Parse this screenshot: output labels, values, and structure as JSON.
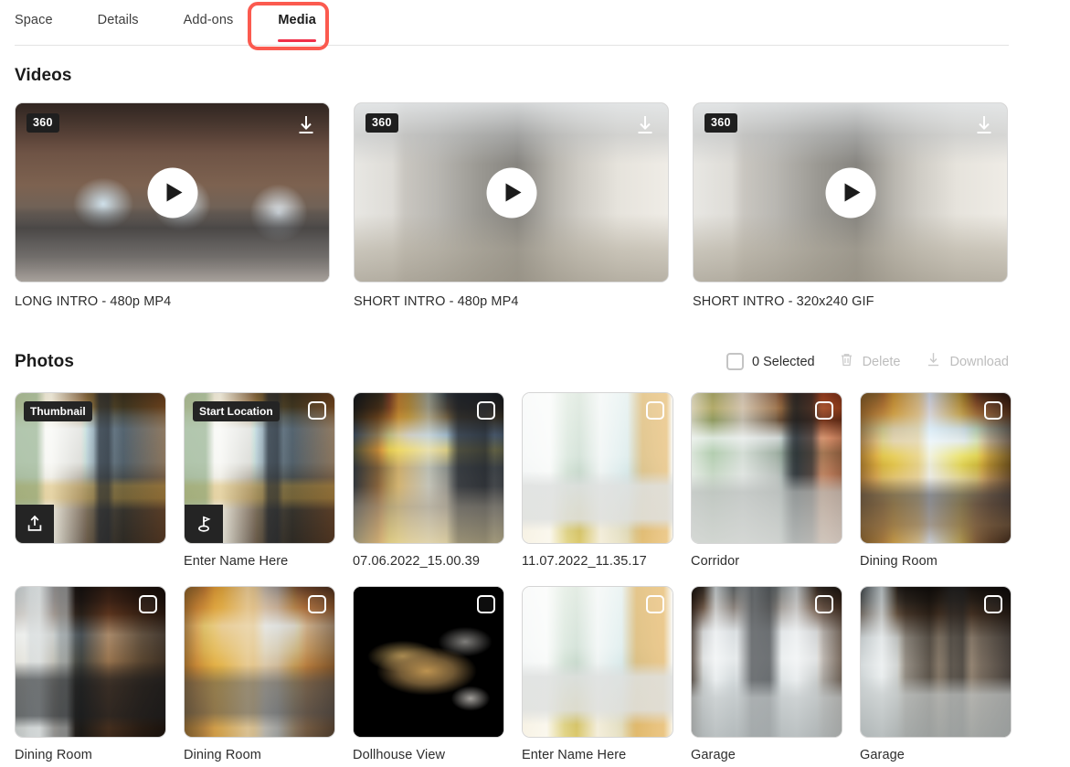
{
  "accent_color": "#f0304a",
  "highlight_color": "#fb5a4f",
  "tabs": [
    {
      "label": "Space",
      "active": false
    },
    {
      "label": "Details",
      "active": false
    },
    {
      "label": "Add-ons",
      "active": false
    },
    {
      "label": "Media",
      "active": true,
      "highlighted": true
    }
  ],
  "videos": {
    "title": "Videos",
    "items": [
      {
        "badge": "360",
        "caption": "LONG INTRO - 480p MP4",
        "download_icon": "download-icon",
        "play_icon": "play-icon"
      },
      {
        "badge": "360",
        "caption": "SHORT INTRO - 480p MP4",
        "download_icon": "download-icon",
        "play_icon": "play-icon"
      },
      {
        "badge": "360",
        "caption": "SHORT INTRO - 320x240 GIF",
        "download_icon": "download-icon",
        "play_icon": "play-icon"
      }
    ]
  },
  "photos": {
    "title": "Photos",
    "toolbar": {
      "selected_label": "0 Selected",
      "delete_label": "Delete",
      "download_label": "Download",
      "delete_enabled": false,
      "download_enabled": false,
      "checkbox_checked": false
    },
    "items": [
      {
        "caption": "",
        "badge": "Thumbnail",
        "corner_action": "upload-icon",
        "checkbox": false,
        "scene": "lounge"
      },
      {
        "caption": "Enter Name Here",
        "badge": "Start Location",
        "corner_action": "start-location-icon",
        "checkbox": true,
        "scene": "lounge"
      },
      {
        "caption": "07.06.2022_15.00.39",
        "badge": null,
        "corner_action": null,
        "checkbox": true,
        "scene": "hall"
      },
      {
        "caption": "11.07.2022_11.35.17",
        "badge": null,
        "corner_action": null,
        "checkbox": true,
        "scene": "sofa"
      },
      {
        "caption": "Corridor",
        "badge": null,
        "corner_action": null,
        "checkbox": true,
        "scene": "corridor"
      },
      {
        "caption": "Dining Room",
        "badge": null,
        "corner_action": null,
        "checkbox": true,
        "scene": "mural"
      },
      {
        "caption": "Dining Room",
        "badge": null,
        "corner_action": null,
        "checkbox": true,
        "scene": "windows"
      },
      {
        "caption": "Dining Room",
        "badge": null,
        "corner_action": null,
        "checkbox": true,
        "scene": "tables"
      },
      {
        "caption": "Dollhouse View",
        "badge": null,
        "corner_action": null,
        "checkbox": true,
        "scene": "dollhouse"
      },
      {
        "caption": "Enter Name Here",
        "badge": null,
        "corner_action": null,
        "checkbox": true,
        "scene": "sofa2"
      },
      {
        "caption": "Garage",
        "badge": null,
        "corner_action": null,
        "checkbox": true,
        "scene": "tanks"
      },
      {
        "caption": "Garage",
        "badge": null,
        "corner_action": null,
        "checkbox": true,
        "scene": "garage"
      }
    ]
  }
}
